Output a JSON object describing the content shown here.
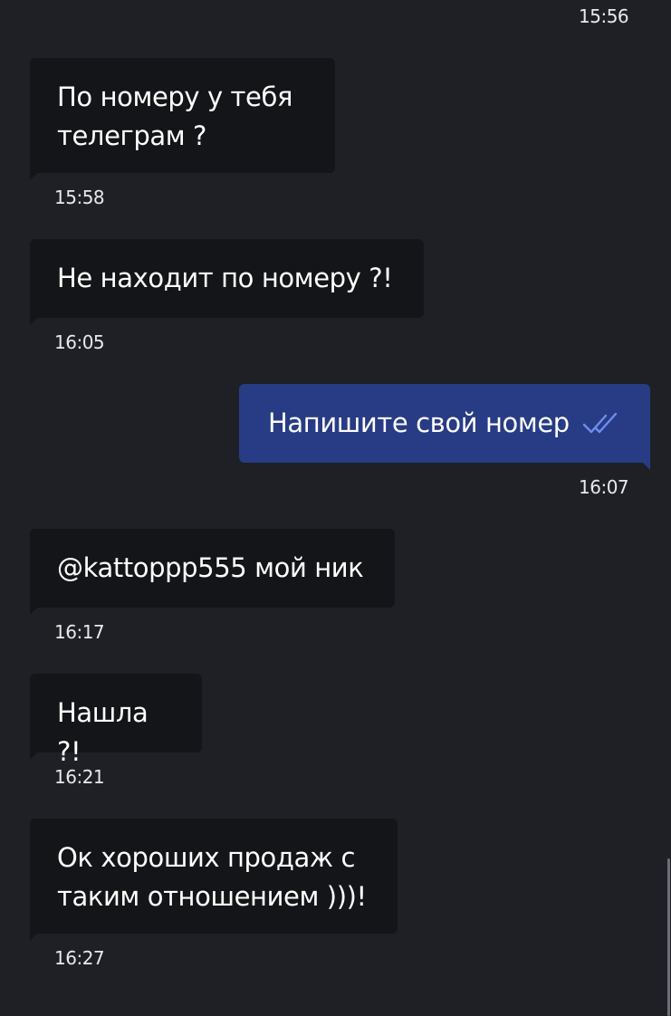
{
  "messages": [
    {
      "direction": "out",
      "time": "15:56"
    },
    {
      "direction": "in",
      "text": "По номеру у тебя\nтелеграм ?",
      "time": "15:58"
    },
    {
      "direction": "in",
      "text": "Не находит по номеру ?!",
      "time": "16:05"
    },
    {
      "direction": "out",
      "text": "Напишите свой номер",
      "time": "16:07",
      "status": "read-double-check-icon"
    },
    {
      "direction": "in",
      "text": "@kattoppp555 мой ник",
      "time": "16:17"
    },
    {
      "direction": "in",
      "text": "Нашла ?!",
      "time": "16:21"
    },
    {
      "direction": "in",
      "text": "Ок хороших продаж с\nтаким отношением )))!",
      "time": "16:27"
    }
  ],
  "colors": {
    "background": "#1f2025",
    "incoming_bubble": "#141519",
    "outgoing_bubble": "#283b85",
    "read_check": "#6f8df0",
    "text": "#ffffff"
  }
}
